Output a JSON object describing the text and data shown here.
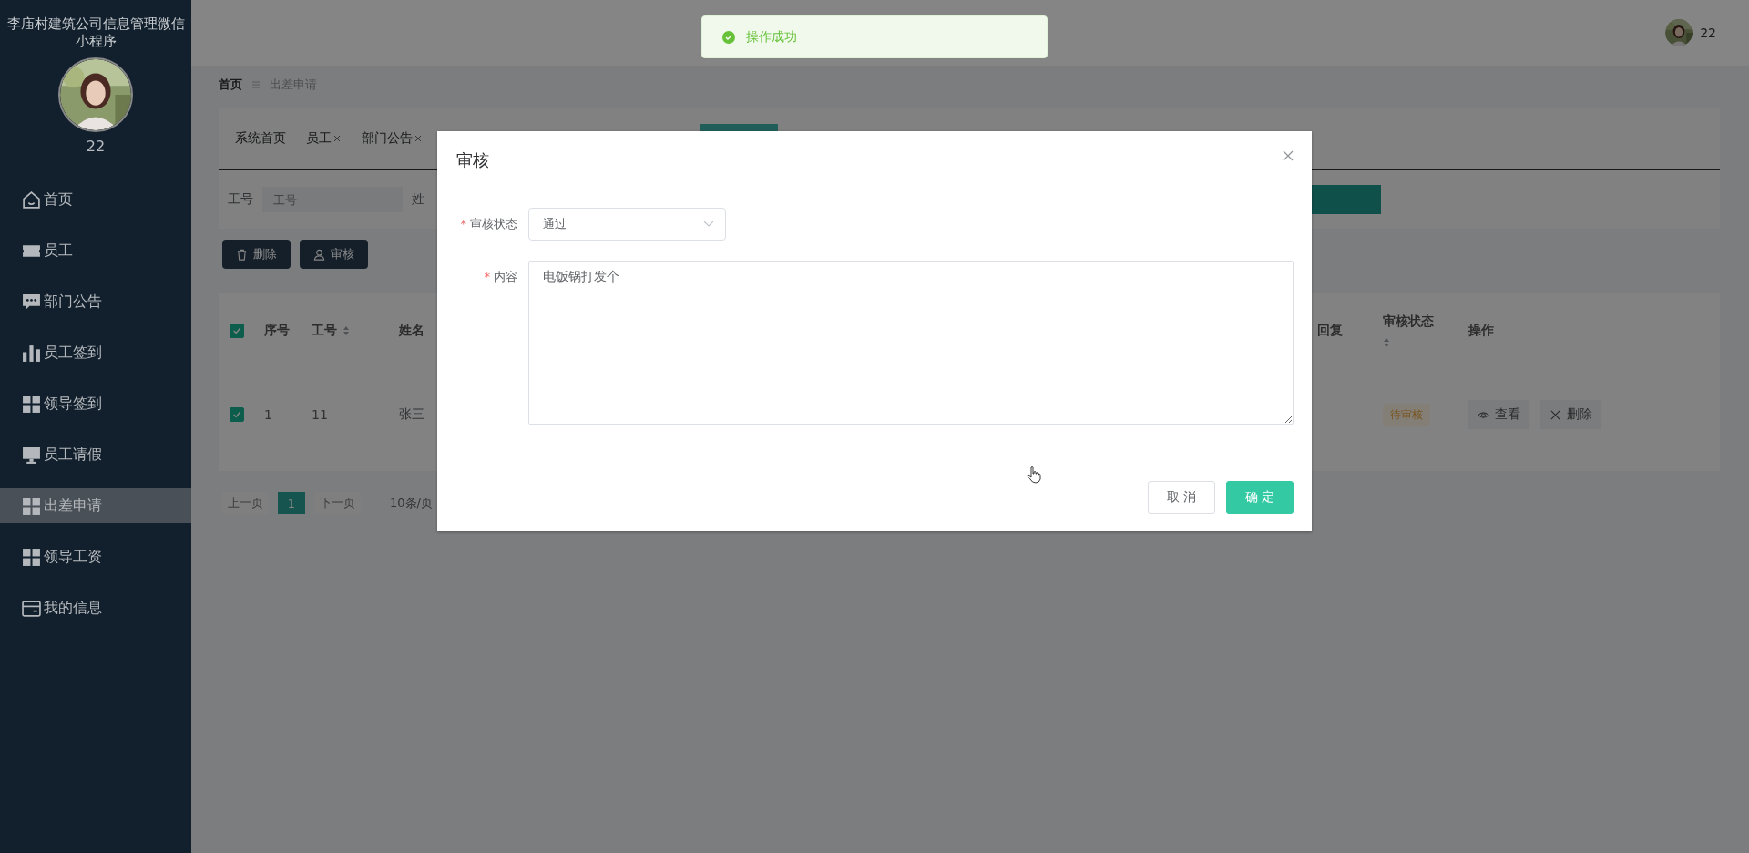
{
  "app_title": "李庙村建筑公司信息管理微信小程序",
  "sidebar": {
    "user_name": "22",
    "items": [
      {
        "label": "首页",
        "selected": false
      },
      {
        "label": "员工",
        "selected": false
      },
      {
        "label": "部门公告",
        "selected": false
      },
      {
        "label": "员工签到",
        "selected": false
      },
      {
        "label": "领导签到",
        "selected": false
      },
      {
        "label": "员工请假",
        "selected": false
      },
      {
        "label": "出差申请",
        "selected": true
      },
      {
        "label": "领导工资",
        "selected": false
      },
      {
        "label": "我的信息",
        "selected": false
      }
    ]
  },
  "header": {
    "user_name": "22"
  },
  "toast": {
    "text": "操作成功"
  },
  "breadcrumb": [
    "首页",
    "出差申请"
  ],
  "tabs": [
    {
      "label": "系统首页",
      "closable": false
    },
    {
      "label": "员工",
      "closable": true
    },
    {
      "label": "部门公告",
      "closable": true
    }
  ],
  "search": {
    "label": "工号",
    "placeholder": "工号",
    "label_2": "姓"
  },
  "toolbar_buttons": [
    {
      "label": "删除"
    },
    {
      "label": "审核"
    }
  ],
  "table": {
    "select_all_checked": true,
    "left_columns": [
      {
        "label": "序号",
        "sortable": false
      },
      {
        "label": "工号",
        "sortable": true
      },
      {
        "label": "姓名",
        "sortable": false
      }
    ],
    "right_columns": [
      {
        "label": "回复",
        "sortable": false
      },
      {
        "label": "审核状态",
        "sortable": true
      },
      {
        "label": "操作",
        "sortable": false
      }
    ],
    "rows": [
      {
        "checked": true,
        "cells": [
          "1",
          "11",
          "张三"
        ],
        "status": "待审核",
        "actions": [
          {
            "label": "查看"
          },
          {
            "label": "删除"
          }
        ]
      }
    ]
  },
  "pagination": {
    "prev": "上一页",
    "pages": [
      {
        "label": "1",
        "selected": true
      }
    ],
    "next": "下一页",
    "page_size": "10条/页"
  },
  "dialog": {
    "title": "审核",
    "fields": [
      {
        "kind": "select",
        "required_mark": "*",
        "label": "审核状态",
        "value": "通过"
      },
      {
        "kind": "textarea",
        "required_mark": "*",
        "label": "内容",
        "value": "电饭锅打发个"
      }
    ],
    "buttons": [
      {
        "label": "取 消",
        "primary": false
      },
      {
        "label": "确 定",
        "primary": true
      }
    ]
  }
}
